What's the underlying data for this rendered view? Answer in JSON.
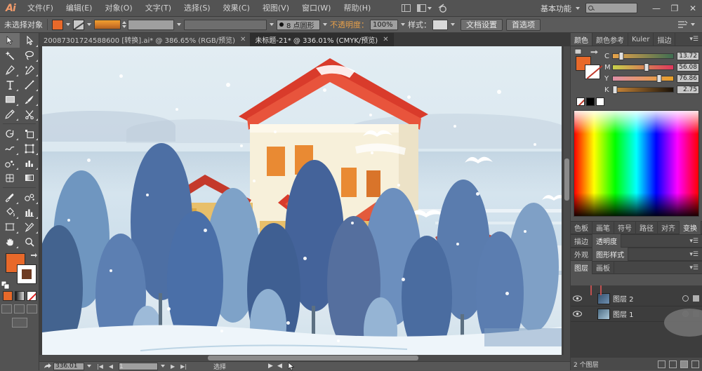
{
  "app": {
    "logo": "Ai",
    "menus": [
      "文件(F)",
      "编辑(E)",
      "对象(O)",
      "文字(T)",
      "选择(S)",
      "效果(C)",
      "视图(V)",
      "窗口(W)",
      "帮助(H)"
    ],
    "workspace_label": "基本功能",
    "search_placeholder": "",
    "window_buttons": [
      "—",
      "❐",
      "✕"
    ]
  },
  "control_bar": {
    "selection_status": "未选择对象",
    "fill_color": "#e8692a",
    "stroke_color": "#c8c8c8",
    "stroke_weight": "",
    "brush_label": "8 点圆形",
    "opacity_label": "不透明度：",
    "opacity_value": "100%",
    "style_label": "样式：",
    "doc_setup_button": "文档设置",
    "preferences_button": "首选项"
  },
  "tabs": [
    {
      "title": "20087301724588600 [转换].ai* @ 386.65% (RGB/预览)",
      "active": false,
      "close": "✕"
    },
    {
      "title": "未标题-21* @ 336.01% (CMYK/预览)",
      "active": true,
      "close": "✕"
    }
  ],
  "toolbar": {
    "tools": [
      "selection-tool",
      "direct-selection-tool",
      "magic-wand-tool",
      "lasso-tool",
      "pen-tool",
      "add-anchor-point-tool",
      "type-tool",
      "line-segment-tool",
      "rectangle-tool",
      "paintbrush-tool",
      "pencil-tool",
      "scissors-tool",
      "rotate-tool",
      "scale-tool",
      "warp-tool",
      "free-transform-tool",
      "symbol-sprayer-tool",
      "column-graph-tool",
      "mesh-tool",
      "gradient-tool",
      "eyedropper-tool",
      "blend-tool",
      "live-paint-bucket-tool",
      "column-graph-tool-2",
      "artboard-tool",
      "slice-tool",
      "hand-tool",
      "zoom-tool"
    ],
    "fill_color": "#e8692a",
    "stroke_color": "#ffffff",
    "color_modes": [
      "color-mode",
      "gradient-mode",
      "none-mode"
    ],
    "draw_modes": [
      "draw-normal",
      "draw-behind",
      "draw-inside"
    ]
  },
  "color_panel": {
    "tabs": [
      "颜色",
      "颜色参考",
      "Kuler",
      "描边"
    ],
    "active_tab": "颜色",
    "mode": "CMYK",
    "sliders": [
      {
        "name": "C",
        "value": "13.72",
        "pct": 13.72,
        "from": "#e8a34a",
        "to": "#3e6e52"
      },
      {
        "name": "M",
        "value": "56.08",
        "pct": 56.08,
        "from": "#c7d14a",
        "to": "#e0365c"
      },
      {
        "name": "Y",
        "value": "76.86",
        "pct": 76.86,
        "from": "#e08fa8",
        "to": "#e8a027"
      },
      {
        "name": "K",
        "value": "2.75",
        "pct": 2.75,
        "from": "#d08a3a",
        "to": "#1a1208"
      }
    ],
    "fill_color": "#e8692a",
    "stroke_color": "#ffffff"
  },
  "dock_panels": {
    "row1": [
      "色板",
      "画笔",
      "符号",
      "路径",
      "对齐",
      "变换"
    ],
    "row1_active": "变换",
    "row2": [
      "描边",
      "透明度"
    ],
    "row2_active": "透明度",
    "row3": [
      "外观",
      "图形样式"
    ],
    "row3_active": "图形样式",
    "row4": [
      "图层",
      "画板"
    ],
    "row4_active": "图层"
  },
  "layers_panel": {
    "rows": [
      {
        "name": "图层 2",
        "visible": true,
        "locked": false,
        "selected": true
      },
      {
        "name": "图层 1",
        "visible": true,
        "locked": false,
        "selected": false
      }
    ],
    "footer_count": "2 个图层"
  },
  "status_bar": {
    "zoom_value": "336.01",
    "artboard_number": "1",
    "status_text": "选择"
  },
  "artwork": {
    "title": "winter-snow-house-illustration",
    "sky_color": "#dce8f0",
    "house_color": "#f6efd9",
    "roof_color": "#d93b2b",
    "tree_colors": [
      "#4a6d9e",
      "#5e7fb4",
      "#7696c4",
      "#3f5f8f",
      "#6d8fbf"
    ],
    "window_color": "#e98a33",
    "snow_color": "#ffffff"
  }
}
